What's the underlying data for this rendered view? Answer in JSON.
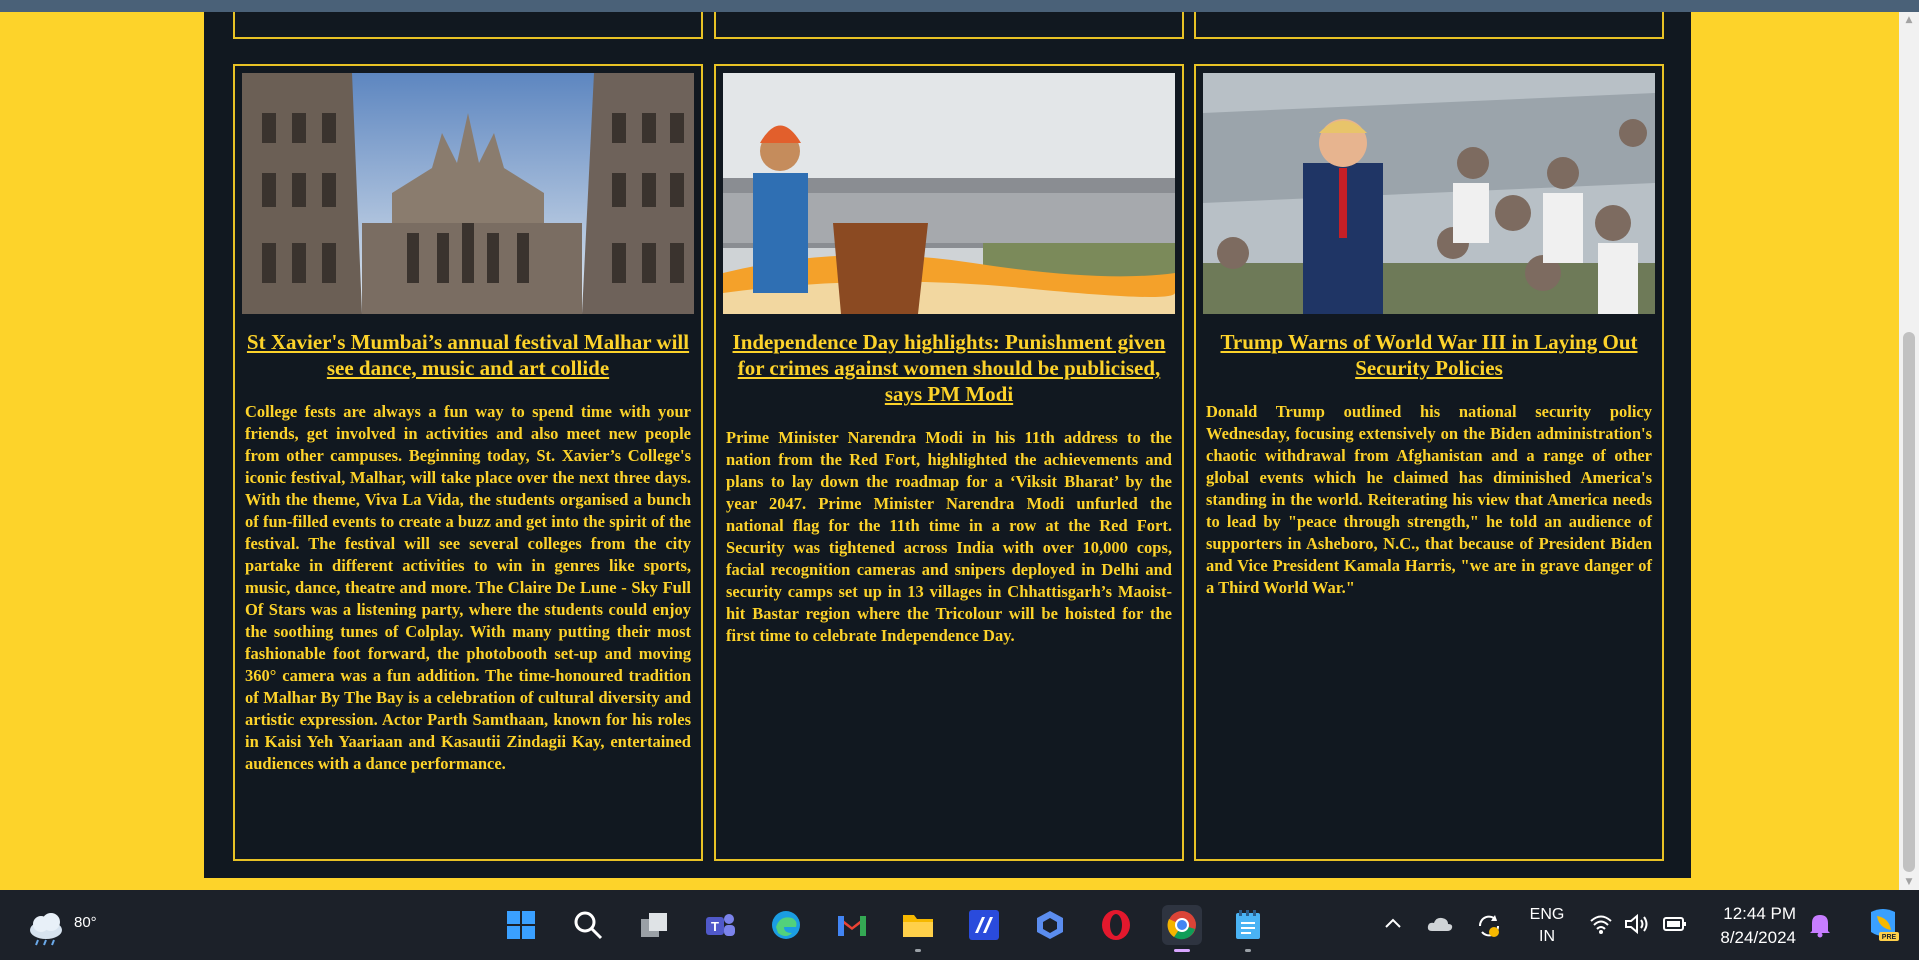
{
  "articles": [
    {
      "title": "St Xavier's Mumbai’s annual festival Malhar will see dance, music and art collide",
      "body": "College fests are always a fun way to spend time with your friends, get involved in activities and also meet new people from other campuses. Beginning today, St. Xavier’s College's iconic festival, Malhar, will take place over the next three days. With the theme, Viva La Vida, the students organised a bunch of fun-filled events to create a buzz and get into the spirit of the festival. The festival will see several colleges from the city partake in different activities to win in genres like sports, music, dance, theatre and more. The Claire De Lune - Sky Full Of Stars was a listening party, where the students could enjoy the soothing tunes of Colplay. With many putting their most fashionable foot forward, the photobooth set-up and moving 360° camera was a fun addition. The time-honoured tradition of Malhar By The Bay is a celebration of cultural diversity and artistic expression. Actor Parth Samthaan, known for his roles in Kaisi Yeh Yaariaan and Kasautii Zindagii Kay, entertained audiences with a dance performance."
    },
    {
      "title": "Independence Day highlights: Punishment given for crimes against women should be publicised, says PM Modi",
      "body": "Prime Minister Narendra Modi in his 11th address to the nation from the Red Fort, highlighted the achievements and plans to lay down the roadmap for a ‘Viksit Bharat’ by the year 2047. Prime Minister Narendra Modi unfurled the national flag for the 11th time in a row at the Red Fort. Security was tightened across India with over 10,000 cops, facial recognition cameras and snipers deployed in Delhi and security camps set up in 13 villages in Chhattisgarh’s Maoist-hit Bastar region where the Tricolour will be hoisted for the first time to celebrate Independence Day."
    },
    {
      "title": "Trump Warns of World War III in Laying Out Security Policies",
      "body": "Donald Trump outlined his national security policy Wednesday, focusing extensively on the Biden administration's chaotic withdrawal from Afghanistan and a range of other global events which he claimed has diminished America's standing in the world. Reiterating his view that America needs to lead by \"peace through strength,\" he told an audience of supporters in Asheboro, N.C., that because of President Biden and Vice President Kamala Harris, \"we are in grave danger of a Third World War.\""
    }
  ],
  "taskbar": {
    "weather_temp": "80°",
    "apps": [
      "start-icon",
      "search-icon",
      "task-view-icon",
      "teams-icon",
      "edge-icon",
      "gmail-icon",
      "file-explorer-icon",
      "app-icon",
      "copilot-icon",
      "opera-icon",
      "chrome-icon",
      "notepad-icon"
    ],
    "language_line1": "ENG",
    "language_line2": "IN",
    "time": "12:44 PM",
    "date": "8/24/2024"
  },
  "colors": {
    "page_bg": "#fdd32a",
    "panel_bg": "#111820",
    "card_border": "#e8c225",
    "text": "#fdd32a"
  }
}
